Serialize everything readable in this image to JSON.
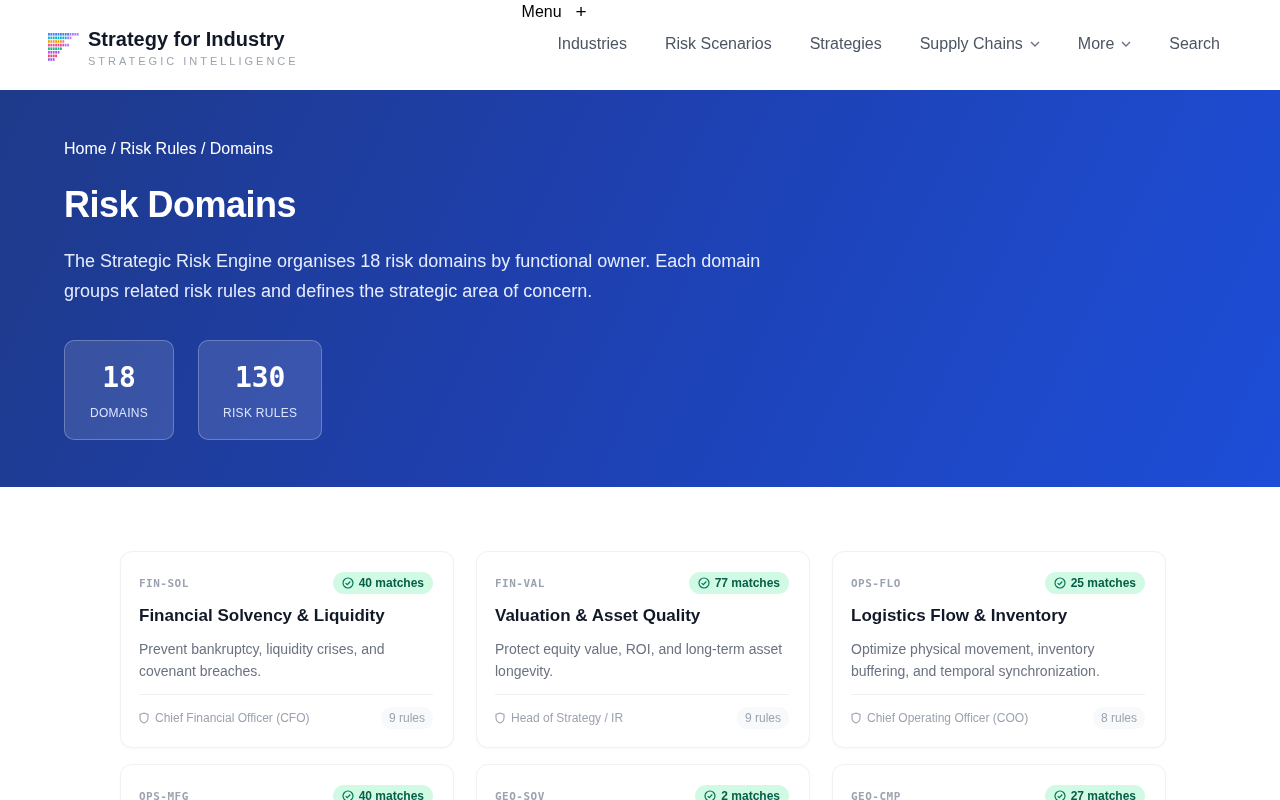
{
  "header": {
    "brand": "Strategy for Industry",
    "tagline": "STRATEGIC INTELLIGENCE",
    "menu_toggle": {
      "label": "Menu",
      "icon": "+"
    },
    "nav": [
      {
        "label": "Industries",
        "dropdown": false
      },
      {
        "label": "Risk Scenarios",
        "dropdown": false
      },
      {
        "label": "Strategies",
        "dropdown": false
      },
      {
        "label": "Supply Chains",
        "dropdown": true
      },
      {
        "label": "More",
        "dropdown": true
      },
      {
        "label": "Search",
        "dropdown": false
      }
    ]
  },
  "hero": {
    "breadcrumb": "Home / Risk Rules / Domains",
    "title": "Risk Domains",
    "description": "The Strategic Risk Engine organises 18 risk domains by functional owner. Each domain groups related risk rules and defines the strategic area of concern.",
    "stats": [
      {
        "value": "18",
        "label": "DOMAINS"
      },
      {
        "value": "130",
        "label": "RISK RULES"
      }
    ]
  },
  "domains": [
    {
      "code": "FIN-SOL",
      "matches": "40 matches",
      "title": "Financial Solvency & Liquidity",
      "description": "Prevent bankruptcy, liquidity crises, and covenant breaches.",
      "owner": "Chief Financial Officer (CFO)",
      "rules": "9 rules"
    },
    {
      "code": "FIN-VAL",
      "matches": "77 matches",
      "title": "Valuation & Asset Quality",
      "description": "Protect equity value, ROI, and long-term asset longevity.",
      "owner": "Head of Strategy / IR",
      "rules": "9 rules"
    },
    {
      "code": "OPS-FLO",
      "matches": "25 matches",
      "title": "Logistics Flow & Inventory",
      "description": "Optimize physical movement, inventory buffering, and temporal synchronization.",
      "owner": "Chief Operating Officer (COO)",
      "rules": "8 rules"
    },
    {
      "code": "OPS-MFG",
      "matches": "40 matches"
    },
    {
      "code": "GEO-SOV",
      "matches": "2 matches"
    },
    {
      "code": "GEO-CMP",
      "matches": "27 matches"
    }
  ]
}
